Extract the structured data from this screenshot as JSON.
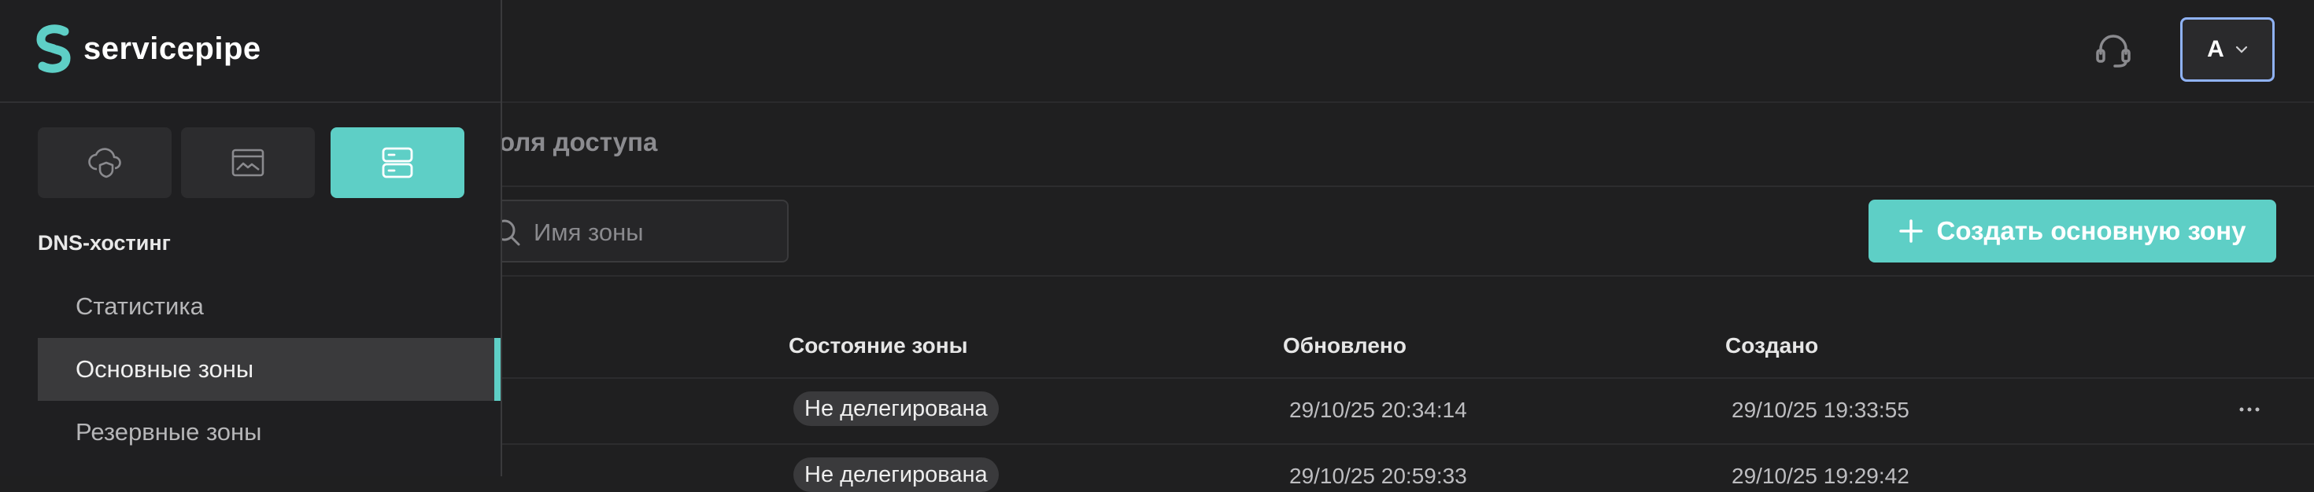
{
  "sidebar": {
    "brand": "servicepipe",
    "section_title": "DNS-хостинг",
    "items": [
      {
        "label": "Статистика"
      },
      {
        "label": "Основные зоны"
      },
      {
        "label": "Резервные зоны"
      }
    ],
    "services": [
      {
        "icon": "cloud-shield-icon"
      },
      {
        "icon": "browser-window-icon"
      },
      {
        "icon": "server-stack-icon",
        "active": true
      }
    ]
  },
  "header": {
    "support_icon": "headset-icon",
    "avatar_letter": "А"
  },
  "main": {
    "tab_label": "оля доступа",
    "search": {
      "placeholder": "Имя зоны"
    },
    "create_button": "Создать основную зону",
    "columns": [
      "Состояние зоны",
      "Обновлено",
      "Создано"
    ],
    "rows": [
      {
        "state": "Не делегирована",
        "updated": "29/10/25 20:34:14",
        "created": "29/10/25 19:33:55"
      },
      {
        "state": "Не делегирована",
        "updated": "29/10/25 20:59:33",
        "created": "29/10/25 19:29:42"
      }
    ]
  },
  "colors": {
    "accent": "#5ecfc6",
    "background": "#1f1f20",
    "panel": "#2c2c2e",
    "focus_ring": "#8fb2f5"
  }
}
